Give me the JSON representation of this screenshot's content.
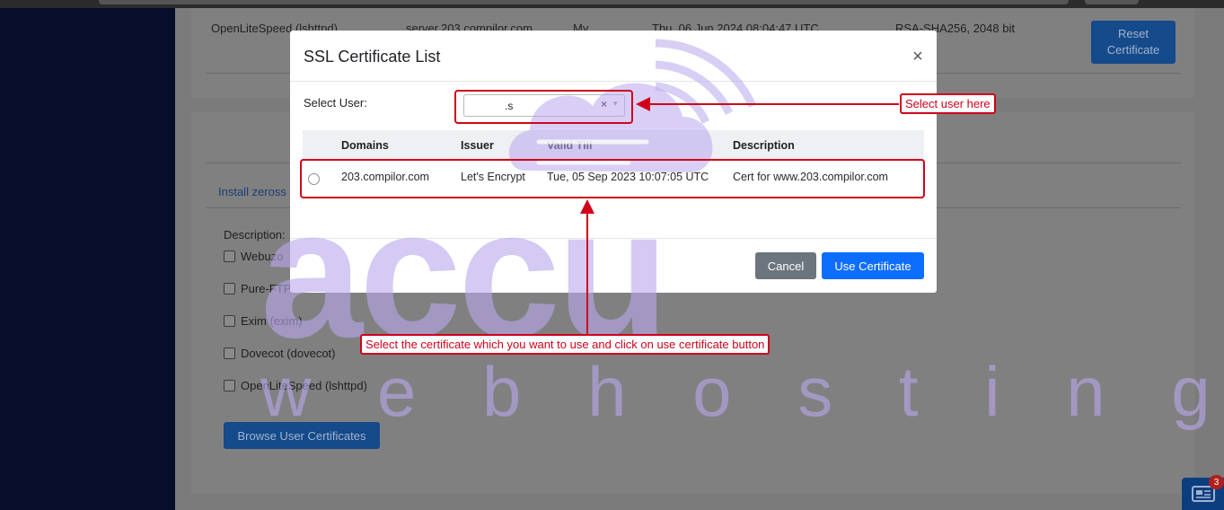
{
  "background_page": {
    "server_row": {
      "service": "OpenLiteSpeed (lshttpd)",
      "hostname": "server.203.compilor.com",
      "issuer_short": "My",
      "date": "Thu, 06 Jun 2024 08:04:47 UTC",
      "algo": "RSA-SHA256, 2048 bit",
      "reset_button": "Reset Certificate"
    },
    "install_link": "Install zeross",
    "description_label": "Description:",
    "services": [
      {
        "label": "Webuzo"
      },
      {
        "label": "Pure-FTP"
      },
      {
        "label": "Exim (exim)"
      },
      {
        "label": "Dovecot (dovecot)"
      },
      {
        "label": "OpenLiteSpeed (lshttpd)"
      }
    ],
    "browse_button": "Browse User Certificates",
    "news_badge_count": "3"
  },
  "modal": {
    "title": "SSL Certificate List",
    "close_glyph": "×",
    "select_user_label": "Select User:",
    "select_value": ".s",
    "select_clear": "×",
    "select_caret": "▾",
    "columns": [
      "Domains",
      "Issuer",
      "Valid Till",
      "Description"
    ],
    "rows": [
      {
        "domain": "203.compilor.com",
        "issuer": "Let's Encrypt",
        "valid_till": "Tue, 05 Sep 2023 10:07:05 UTC",
        "description": "Cert for www.203.compilor.com"
      }
    ],
    "cancel_button": "Cancel",
    "use_button": "Use Certificate"
  },
  "annotations": {
    "select_user_callout": "Select user here",
    "select_cert_callout": "Select the certificate which you want to use and click on use certificate button",
    "color": "#d0021b"
  },
  "watermark": {
    "big_text": "accu",
    "sub_text": "w e b   h o s t i n g",
    "color": "#b9a8ee"
  }
}
